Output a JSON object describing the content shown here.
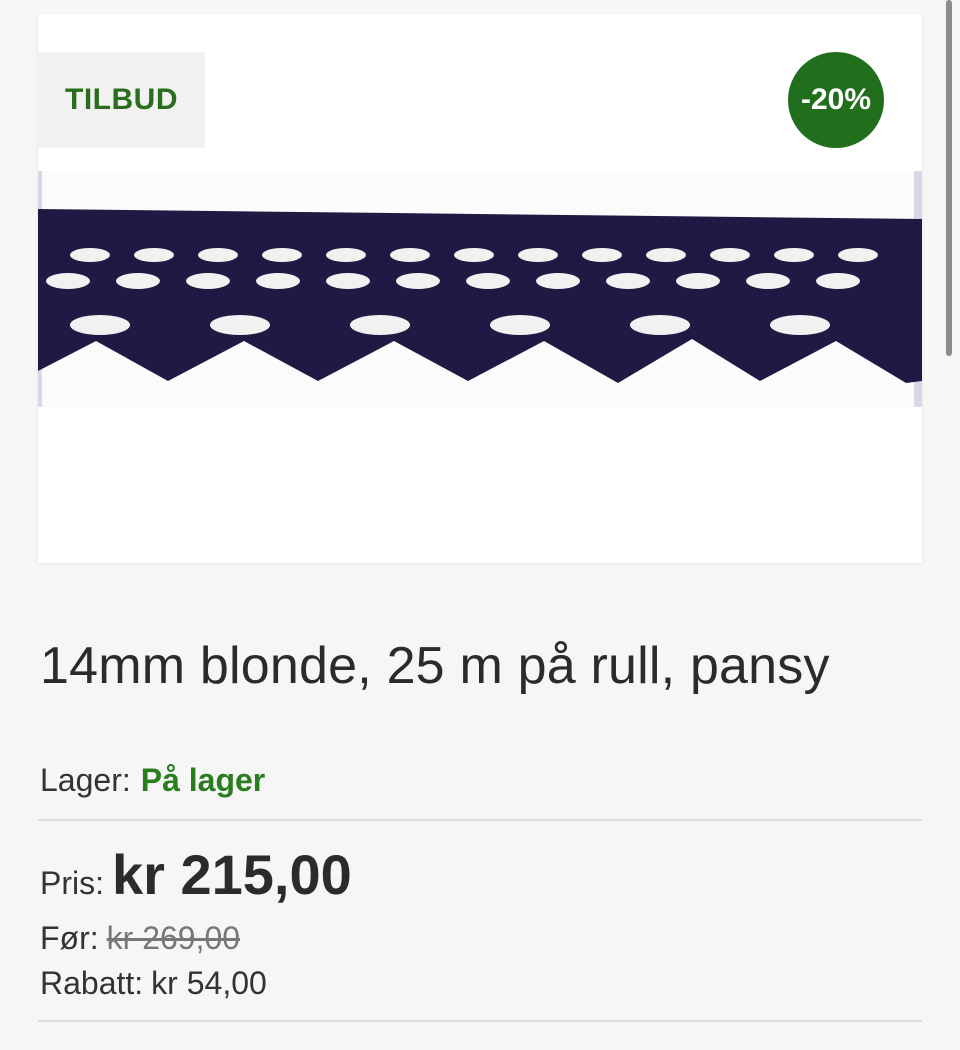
{
  "product": {
    "sale_label": "TILBUD",
    "discount_badge": "-20%",
    "title": "14mm blonde, 25 m på rull, pansy",
    "image_icon": "lace-trim-image",
    "stock": {
      "label": "Lager:",
      "value": "På lager"
    },
    "price": {
      "label": "Pris:",
      "value": "kr 215,00"
    },
    "before": {
      "label": "Før:",
      "value": "kr 269,00"
    },
    "discount": {
      "label": "Rabatt:",
      "value": "kr 54,00"
    }
  },
  "colors": {
    "accent_green": "#216f1c",
    "stock_green": "#2a7d1e",
    "lace_color": "#1f1a44",
    "background": "#f6f6f6"
  }
}
